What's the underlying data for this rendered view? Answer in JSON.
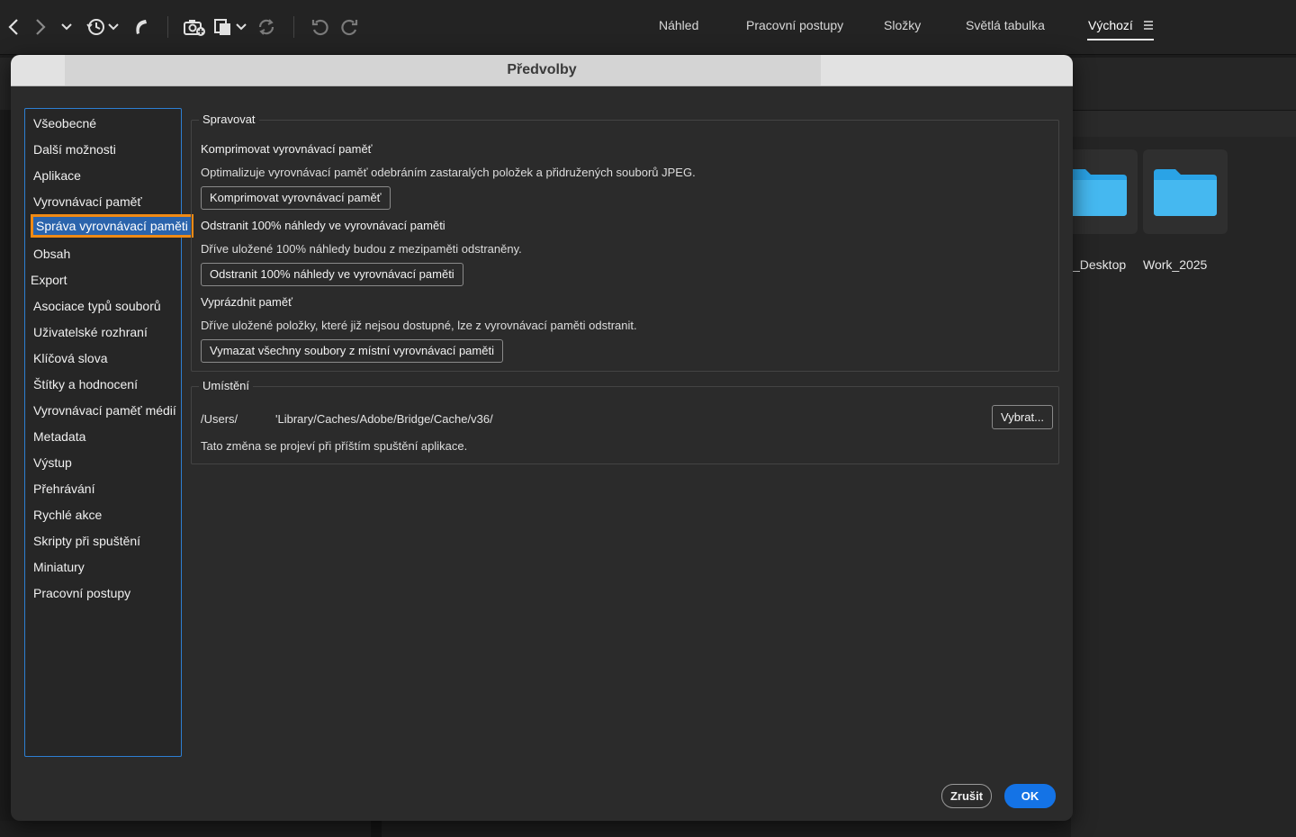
{
  "toolbar": {
    "icons": [
      "back-arrow-icon",
      "forward-arrow-icon",
      "chevron-down-icon",
      "recent-history-icon",
      "boomerang-icon",
      "camera-import-icon",
      "copy-files-icon",
      "sync-refresh-icon",
      "undo-icon",
      "redo-icon"
    ]
  },
  "workspaces": {
    "tabs": [
      {
        "label": "Náhled"
      },
      {
        "label": "Pracovní postupy"
      },
      {
        "label": "Složky"
      },
      {
        "label": "Světlá tabulka"
      },
      {
        "label": "Výchozí",
        "active": true
      }
    ]
  },
  "background_folders": [
    {
      "label": "_Desktop"
    },
    {
      "label": "Work_2025"
    }
  ],
  "dialog": {
    "title": "Předvolby",
    "nav": [
      "Všeobecné",
      "Další možnosti",
      "Aplikace",
      "Vyrovnávací paměť",
      "Správa vyrovnávací paměti",
      "Obsah",
      "Export",
      "Asociace typů souborů",
      "Uživatelské rozhraní",
      "Klíčová slova",
      "Štítky a hodnocení",
      "Vyrovnávací paměť médií",
      "Metadata",
      "Výstup",
      "Přehrávání",
      "Rychlé akce",
      "Skripty při spuštění",
      "Miniatury",
      "Pracovní postupy"
    ],
    "selected_nav": "Správa vyrovnávací paměti",
    "manage": {
      "title": "Spravovat",
      "compact_heading": "Komprimovat vyrovnávací paměť",
      "compact_desc": "Optimalizuje vyrovnávací paměť odebráním zastaralých položek a přidružených souborů JPEG.",
      "compact_button": "Komprimovat vyrovnávací paměť",
      "purge100_heading": "Odstranit 100% náhledy ve vyrovnávací paměti",
      "purge100_desc": "Dříve uložené 100% náhledy budou z mezipaměti odstraněny.",
      "purge100_button": "Odstranit 100% náhledy ve vyrovnávací paměti",
      "clear_heading": "Vyprázdnit paměť",
      "clear_desc": "Dříve uložené položky, které již nejsou dostupné, lze z vyrovnávací paměti odstranit.",
      "clear_button": "Vymazat všechny soubory z místní vyrovnávací paměti"
    },
    "location": {
      "title": "Umístění",
      "path_start": "/Users/",
      "path_end": "'Library/Caches/Adobe/Bridge/Cache/v36/",
      "choose_button": "Vybrat...",
      "note": "Tato změna se projeví při příštím spuštění aplikace."
    },
    "cancel_button": "Zrušit",
    "ok_button": "OK"
  }
}
